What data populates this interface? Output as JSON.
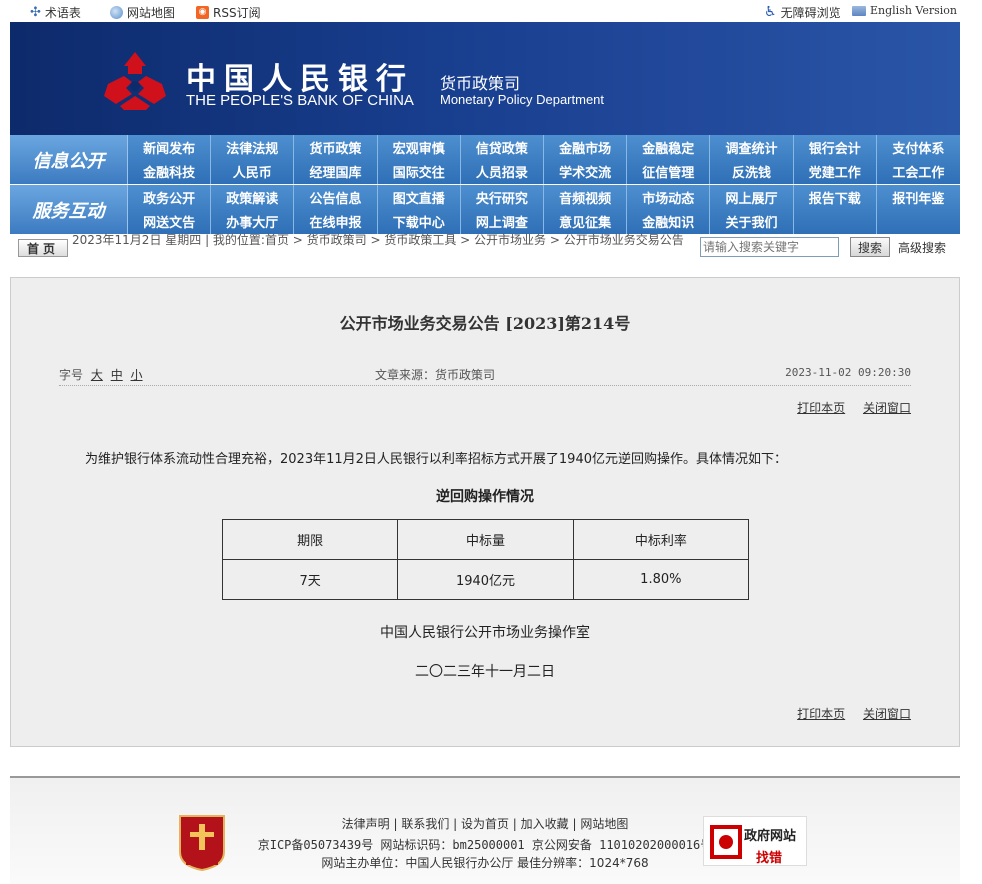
{
  "topbar": {
    "glossary": "术语表",
    "sitemap": "网站地图",
    "rss": "RSS订阅",
    "accessibility": "无障碍浏览",
    "english": "English Version"
  },
  "banner": {
    "bank_cn": "中国人民银行",
    "bank_en": "THE PEOPLE'S BANK OF CHINA",
    "dept_cn": "货币政策司",
    "dept_en": "Monetary Policy Department"
  },
  "nav": {
    "row1_label": "信息公开",
    "row1_items": [
      "新闻发布",
      "法律法规",
      "货币政策",
      "宏观审慎",
      "信贷政策",
      "金融市场",
      "金融稳定",
      "调查统计",
      "银行会计",
      "支付体系",
      "金融科技",
      "人民币",
      "经理国库",
      "国际交往",
      "人员招录",
      "学术交流",
      "征信管理",
      "反洗钱",
      "党建工作",
      "工会工作"
    ],
    "row2_label": "服务互动",
    "row2_items": [
      "政务公开",
      "政策解读",
      "公告信息",
      "图文直播",
      "央行研究",
      "音频视频",
      "市场动态",
      "网上展厅",
      "报告下载",
      "报刊年鉴",
      "网送文告",
      "办事大厅",
      "在线申报",
      "下载中心",
      "网上调查",
      "意见征集",
      "金融知识",
      "关于我们",
      "",
      ""
    ]
  },
  "crumbbar": {
    "home": "首页",
    "crumb": "2023年11月2日 星期四 | 我的位置:首页 > 货币政策司 > 货币政策工具 > 公开市场业务 > 公开市场业务交易公告",
    "search_placeholder": "请输入搜索关键字",
    "search_btn": "搜索",
    "advanced": "高级搜索"
  },
  "article": {
    "title": "公开市场业务交易公告 [2023]第214号",
    "font_label": "字号",
    "font_big": "大",
    "font_mid": "中",
    "font_small": "小",
    "source": "文章来源：货币政策司",
    "datetime": "2023-11-02 09:20:30",
    "print": "打印本页",
    "close": "关闭窗口",
    "paragraph": "为维护银行体系流动性合理充裕，2023年11月2日人民银行以利率招标方式开展了1940亿元逆回购操作。具体情况如下：",
    "table_caption": "逆回购操作情况",
    "table_headers": [
      "期限",
      "中标量",
      "中标利率"
    ],
    "table_row": [
      "7天",
      "1940亿元",
      "1.80%"
    ],
    "signature": "中国人民银行公开市场业务操作室",
    "date_cn": "二〇二三年十一月二日"
  },
  "footer": {
    "links": "法律声明 | 联系我们 | 设为首页 | 加入收藏 | 网站地图",
    "icp": "京ICP备05073439号  网站标识码：bm25000001  京公网安备 11010202000016号",
    "owner": "网站主办单位：中国人民银行办公厅  最佳分辨率：1024*768",
    "badge_text": "党政机关",
    "err_title": "政府网站",
    "err_sub": "找错"
  },
  "colors": {
    "banner": "#183e8e",
    "nav": "#3c7bc1",
    "logo_red": "#d0101a"
  }
}
